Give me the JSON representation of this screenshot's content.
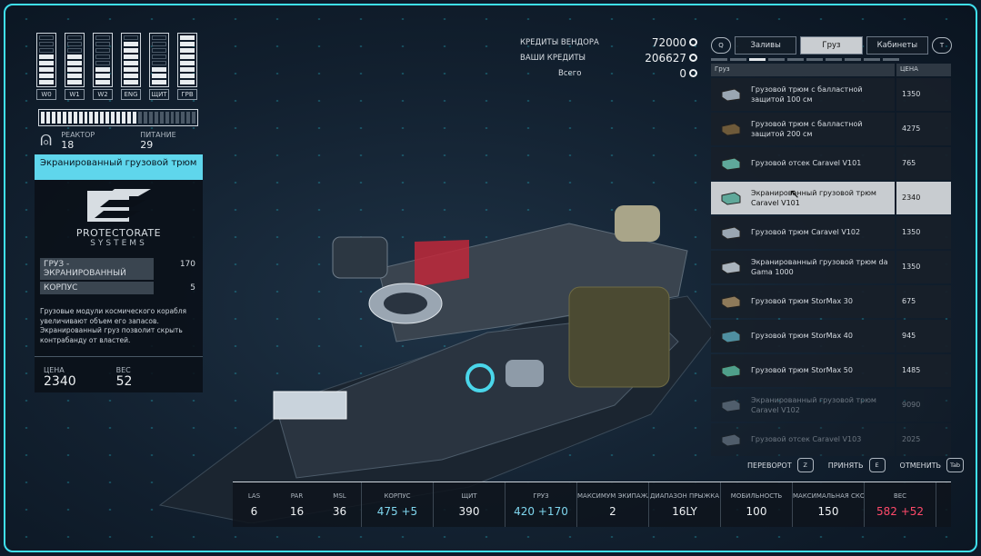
{
  "systems": [
    {
      "label": "W0",
      "level": 5,
      "max": 8
    },
    {
      "label": "W1",
      "level": 5,
      "max": 8
    },
    {
      "label": "W2",
      "level": 3,
      "max": 8
    },
    {
      "label": "ENG",
      "level": 7,
      "max": 8
    },
    {
      "label": "ЩИТ",
      "level": 3,
      "max": 8
    },
    {
      "label": "ГРВ",
      "level": 8,
      "max": 8
    }
  ],
  "reactor_fill": 0.62,
  "reactor": {
    "label": "РЕАКТОР",
    "value": "18"
  },
  "power": {
    "label": "ПИТАНИЕ",
    "value": "29"
  },
  "item": {
    "title": "Экранированный грузовой трюм",
    "brand_main": "PROTECTORATE",
    "brand_sub": "SYSTEMS",
    "props": [
      {
        "name": "ГРУЗ - ЭКРАНИРОВАННЫЙ",
        "value": "170"
      },
      {
        "name": "КОРПУС",
        "value": "5"
      }
    ],
    "description": "Грузовые модули космического корабля увеличивают объем его запасов. Экранированный груз позволит скрыть контрабанду от властей.",
    "price_label": "ЦЕНА",
    "price": "2340",
    "weight_label": "ВЕС",
    "weight": "52"
  },
  "credits": {
    "vendor_label": "КРЕДИТЫ ВЕНДОРА",
    "vendor": "72000",
    "yours_label": "ВАШИ КРЕДИТЫ",
    "yours": "206627",
    "total_label": "Всего",
    "total": "0"
  },
  "tabs": {
    "left_key": "Q",
    "right_key": "T",
    "items": [
      "Заливы",
      "Груз",
      "Кабинеты"
    ],
    "active": 1
  },
  "list": {
    "col_name": "Груз",
    "col_price": "ЦЕНА",
    "rows": [
      {
        "name": "Грузовой трюм с балластной защитой 100 см",
        "price": "1350",
        "state": "normal"
      },
      {
        "name": "Грузовой трюм с балластной защитой 200 см",
        "price": "4275",
        "state": "normal"
      },
      {
        "name": "Грузовой отсек Caravel V101",
        "price": "765",
        "state": "normal"
      },
      {
        "name": "Экранированный грузовой трюм Caravel V101",
        "price": "2340",
        "state": "selected"
      },
      {
        "name": "Грузовой трюм Caravel V102",
        "price": "1350",
        "state": "normal"
      },
      {
        "name": "Экранированный грузовой трюм da Gama 1000",
        "price": "1350",
        "state": "normal"
      },
      {
        "name": "Грузовой трюм StorMax 30",
        "price": "675",
        "state": "normal"
      },
      {
        "name": "Грузовой трюм StorMax 40",
        "price": "945",
        "state": "normal"
      },
      {
        "name": "Грузовой трюм StorMax 50",
        "price": "1485",
        "state": "normal"
      },
      {
        "name": "Экранированный грузовой трюм Caravel V102",
        "price": "9090",
        "state": "dim"
      },
      {
        "name": "Грузовой отсек Caravel V103",
        "price": "2025",
        "state": "dim"
      }
    ]
  },
  "hotkeys": [
    {
      "label": "ПЕРЕВОРОТ",
      "key": "Z"
    },
    {
      "label": "ПРИНЯТЬ",
      "key": "E"
    },
    {
      "label": "ОТМЕНИТЬ",
      "key": "Tab"
    }
  ],
  "bottom_stats": [
    {
      "label": "LAS",
      "value": "6",
      "style": "normal"
    },
    {
      "label": "PAR",
      "value": "16",
      "style": "normal"
    },
    {
      "label": "MSL",
      "value": "36",
      "style": "normal"
    },
    {
      "label": "КОРПУС",
      "value": "475 +5",
      "style": "up"
    },
    {
      "label": "ЩИТ",
      "value": "390",
      "style": "normal"
    },
    {
      "label": "ГРУЗ",
      "value": "420 +170",
      "style": "up"
    },
    {
      "label": "МАКСИМУМ ЭКИПАЖА",
      "value": "2",
      "style": "normal"
    },
    {
      "label": "ДИАПАЗОН ПРЫЖКА",
      "value": "16LY",
      "style": "normal"
    },
    {
      "label": "МОБИЛЬНОСТЬ",
      "value": "100",
      "style": "normal"
    },
    {
      "label": "МАКСИМАЛЬНАЯ СКОРОСТЬ",
      "value": "150",
      "style": "normal"
    },
    {
      "label": "ВЕС",
      "value": "582 +52",
      "style": "red"
    }
  ]
}
